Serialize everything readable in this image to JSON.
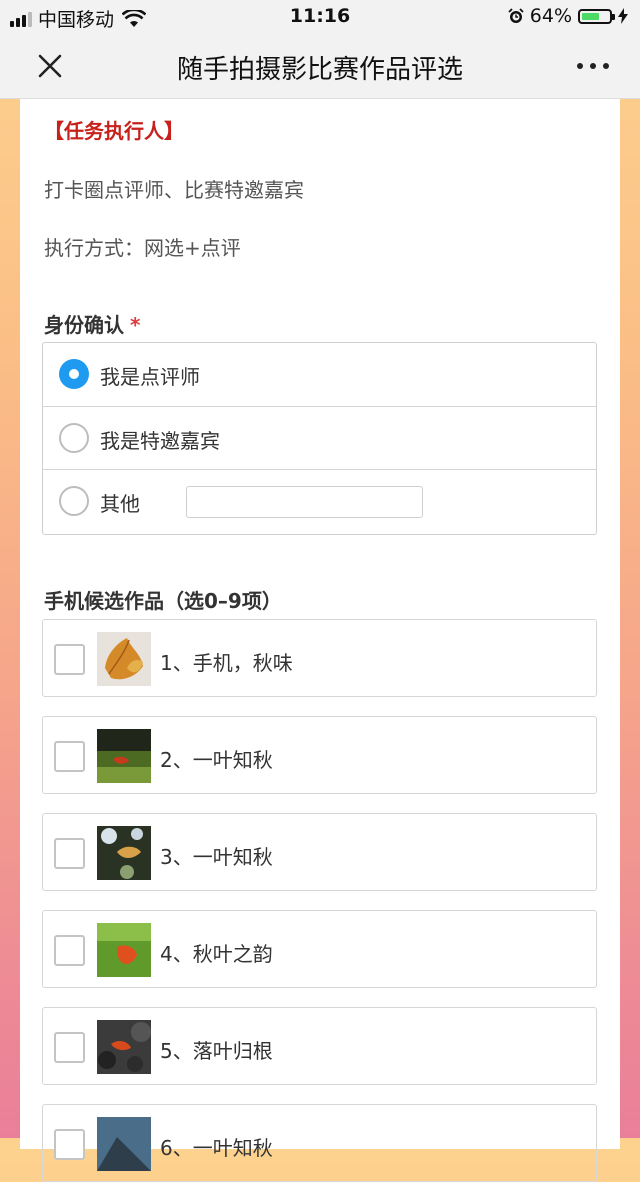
{
  "status_bar": {
    "carrier": "中国移动",
    "time": "11:16",
    "battery_percent": "64%",
    "battery_level": 0.64
  },
  "nav": {
    "title": "随手拍摄影比赛作品评选"
  },
  "form": {
    "section_heading": "【任务执行人】",
    "executor_line": "打卡圈点评师、比赛特邀嘉宾",
    "method_line": "执行方式：网选+点评",
    "identity": {
      "label": "身份确认",
      "required_mark": "*",
      "options": [
        {
          "label": "我是点评师",
          "selected": true
        },
        {
          "label": "我是特邀嘉宾",
          "selected": false
        },
        {
          "label": "其他",
          "selected": false
        }
      ],
      "other_value": ""
    },
    "candidates": {
      "label": "手机候选作品（选0–9项）",
      "items": [
        {
          "label": "1、手机，秋味",
          "checked": false
        },
        {
          "label": "2、一叶知秋",
          "checked": false
        },
        {
          "label": "3、一叶知秋",
          "checked": false
        },
        {
          "label": "4、秋叶之韵",
          "checked": false
        },
        {
          "label": "5、落叶归根",
          "checked": false
        },
        {
          "label": "6、一叶知秋",
          "checked": false
        }
      ]
    }
  },
  "colors": {
    "accent_blue": "#1e9bf0",
    "heading_red": "#c8211c",
    "required_red": "#e0393e",
    "battery_green": "#4cd964"
  }
}
